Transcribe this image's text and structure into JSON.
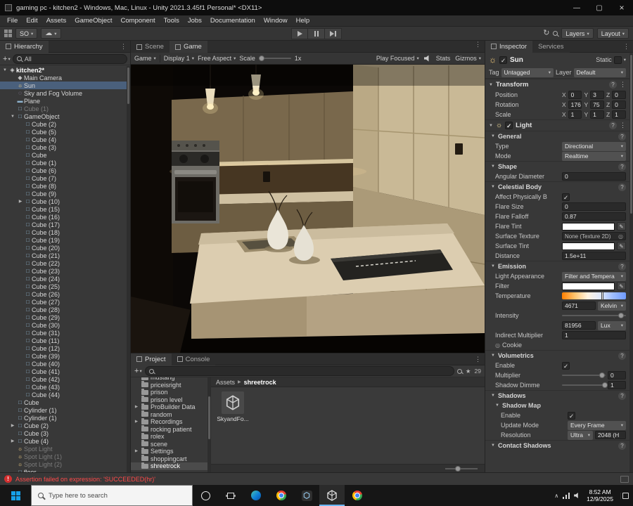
{
  "window": {
    "title": "gaming pc - kitchen2 - Windows, Mac, Linux - Unity 2021.3.45f1 Personal* <DX11>"
  },
  "menu": {
    "items": [
      "File",
      "Edit",
      "Assets",
      "GameObject",
      "Component",
      "Tools",
      "Jobs",
      "Documentation",
      "Window",
      "Help"
    ]
  },
  "toolbar": {
    "account_label": "SO",
    "layers_label": "Layers",
    "layout_label": "Layout"
  },
  "hierarchy": {
    "tab": "Hierarchy",
    "search_value": "All",
    "items": [
      {
        "label": "kitchen2*",
        "indent": 0,
        "icon": "unity",
        "arrow": "open",
        "root": true
      },
      {
        "label": "Main Camera",
        "indent": 1,
        "icon": "camera"
      },
      {
        "label": "Sun",
        "indent": 1,
        "icon": "light",
        "state": "selected"
      },
      {
        "label": "Sky and Fog Volume",
        "indent": 1,
        "icon": "volume"
      },
      {
        "label": "Plane",
        "indent": 1,
        "icon": "plane"
      },
      {
        "label": "Cube (1)",
        "indent": 1,
        "icon": "cube",
        "state": "disabled"
      },
      {
        "label": "GameObject",
        "indent": 1,
        "icon": "cube",
        "arrow": "open"
      },
      {
        "label": "Cube (2)",
        "indent": 2,
        "icon": "cube"
      },
      {
        "label": "Cube (5)",
        "indent": 2,
        "icon": "cube"
      },
      {
        "label": "Cube (4)",
        "indent": 2,
        "icon": "cube"
      },
      {
        "label": "Cube (3)",
        "indent": 2,
        "icon": "cube"
      },
      {
        "label": "Cube",
        "indent": 2,
        "icon": "cube"
      },
      {
        "label": "Cube (1)",
        "indent": 2,
        "icon": "cube"
      },
      {
        "label": "Cube (6)",
        "indent": 2,
        "icon": "cube"
      },
      {
        "label": "Cube (7)",
        "indent": 2,
        "icon": "cube"
      },
      {
        "label": "Cube (8)",
        "indent": 2,
        "icon": "cube"
      },
      {
        "label": "Cube (9)",
        "indent": 2,
        "icon": "cube"
      },
      {
        "label": "Cube (10)",
        "indent": 2,
        "icon": "cube",
        "arrow": "closed"
      },
      {
        "label": "Cube (15)",
        "indent": 2,
        "icon": "cube"
      },
      {
        "label": "Cube (16)",
        "indent": 2,
        "icon": "cube"
      },
      {
        "label": "Cube (17)",
        "indent": 2,
        "icon": "cube"
      },
      {
        "label": "Cube (18)",
        "indent": 2,
        "icon": "cube"
      },
      {
        "label": "Cube (19)",
        "indent": 2,
        "icon": "cube"
      },
      {
        "label": "Cube (20)",
        "indent": 2,
        "icon": "cube"
      },
      {
        "label": "Cube (21)",
        "indent": 2,
        "icon": "cube"
      },
      {
        "label": "Cube (22)",
        "indent": 2,
        "icon": "cube"
      },
      {
        "label": "Cube (23)",
        "indent": 2,
        "icon": "cube"
      },
      {
        "label": "Cube (24)",
        "indent": 2,
        "icon": "cube"
      },
      {
        "label": "Cube (25)",
        "indent": 2,
        "icon": "cube"
      },
      {
        "label": "Cube (26)",
        "indent": 2,
        "icon": "cube"
      },
      {
        "label": "Cube (27)",
        "indent": 2,
        "icon": "cube"
      },
      {
        "label": "Cube (28)",
        "indent": 2,
        "icon": "cube"
      },
      {
        "label": "Cube (29)",
        "indent": 2,
        "icon": "cube"
      },
      {
        "label": "Cube (30)",
        "indent": 2,
        "icon": "cube"
      },
      {
        "label": "Cube (31)",
        "indent": 2,
        "icon": "cube"
      },
      {
        "label": "Cube (11)",
        "indent": 2,
        "icon": "cube"
      },
      {
        "label": "Cube (12)",
        "indent": 2,
        "icon": "cube"
      },
      {
        "label": "Cube (39)",
        "indent": 2,
        "icon": "cube"
      },
      {
        "label": "Cube (40)",
        "indent": 2,
        "icon": "cube"
      },
      {
        "label": "Cube (41)",
        "indent": 2,
        "icon": "cube"
      },
      {
        "label": "Cube (42)",
        "indent": 2,
        "icon": "cube"
      },
      {
        "label": "Cube (43)",
        "indent": 2,
        "icon": "cube"
      },
      {
        "label": "Cube (44)",
        "indent": 2,
        "icon": "cube"
      },
      {
        "label": "Cube",
        "indent": 1,
        "icon": "cube"
      },
      {
        "label": "Cylinder (1)",
        "indent": 1,
        "icon": "cube"
      },
      {
        "label": "Cylinder (1)",
        "indent": 1,
        "icon": "cube"
      },
      {
        "label": "Cube (2)",
        "indent": 1,
        "icon": "cube",
        "arrow": "closed"
      },
      {
        "label": "Cube (3)",
        "indent": 1,
        "icon": "cube"
      },
      {
        "label": "Cube (4)",
        "indent": 1,
        "icon": "cube",
        "arrow": "closed"
      },
      {
        "label": "Spot Light",
        "indent": 1,
        "icon": "light",
        "state": "disabled"
      },
      {
        "label": "Spot Light (1)",
        "indent": 1,
        "icon": "light",
        "state": "disabled"
      },
      {
        "label": "Spot Light (2)",
        "indent": 1,
        "icon": "light",
        "state": "disabled"
      },
      {
        "label": "floor",
        "indent": 1,
        "icon": "cube"
      }
    ]
  },
  "scene_tabs": {
    "scene": "Scene",
    "game": "Game"
  },
  "game_toolbar": {
    "display_target": "Game",
    "display": "Display 1",
    "aspect": "Free Aspect",
    "scale_label": "Scale",
    "scale_value": "1x",
    "focus_mode": "Play Focused",
    "stats_label": "Stats",
    "gizmos_label": "Gizmos"
  },
  "project": {
    "tab_project": "Project",
    "tab_console": "Console",
    "hidden_count": "29",
    "folders": [
      {
        "label": "mustang"
      },
      {
        "label": "priceisright"
      },
      {
        "label": "prison"
      },
      {
        "label": "prison level"
      },
      {
        "label": "ProBuilder Data",
        "arrow": true
      },
      {
        "label": "random"
      },
      {
        "label": "Recordings",
        "arrow": true
      },
      {
        "label": "rocking patient"
      },
      {
        "label": "rolex"
      },
      {
        "label": "scene"
      },
      {
        "label": "Settings",
        "arrow": true
      },
      {
        "label": "shoppingcart"
      },
      {
        "label": "shreetrock",
        "selected": true
      }
    ],
    "breadcrumb": {
      "root": "Assets",
      "current": "shreetrock"
    },
    "assets": [
      {
        "label": "SkyandFo..."
      }
    ]
  },
  "inspector": {
    "tab_inspector": "Inspector",
    "tab_services": "Services",
    "header": {
      "name": "Sun",
      "static_label": "Static"
    },
    "tag_label": "Tag",
    "tag_value": "Untagged",
    "layer_label": "Layer",
    "layer_value": "Default",
    "transform": {
      "title": "Transform",
      "axes": [
        "X",
        "Y",
        "Z"
      ],
      "rows": [
        {
          "label": "Position",
          "x": "0",
          "y": "3",
          "z": "0"
        },
        {
          "label": "Rotation",
          "x": "176.5",
          "y": "75",
          "z": "0"
        },
        {
          "label": "Scale",
          "x": "1",
          "y": "1",
          "z": "1"
        }
      ]
    },
    "light": {
      "title": "Light",
      "sections": [
        {
          "title": "General",
          "rows": [
            {
              "label": "Type",
              "control": "dropdown",
              "value": "Directional"
            },
            {
              "label": "Mode",
              "control": "dropdown",
              "value": "Realtime"
            }
          ]
        },
        {
          "title": "Shape",
          "rows": [
            {
              "label": "Angular Diameter",
              "control": "number",
              "value": "0"
            }
          ]
        },
        {
          "title": "Celestial Body",
          "rows": [
            {
              "label": "Affect Physically B",
              "control": "check",
              "checked": true
            },
            {
              "label": "Flare Size",
              "control": "number",
              "value": "0"
            },
            {
              "label": "Flare Falloff",
              "control": "number",
              "value": "0.87"
            },
            {
              "label": "Flare Tint",
              "control": "color"
            },
            {
              "label": "Surface Texture",
              "control": "object",
              "value": "None (Texture 2D)"
            },
            {
              "label": "Surface Tint",
              "control": "color"
            },
            {
              "label": "Distance",
              "control": "number",
              "value": "1.5e+11"
            }
          ]
        },
        {
          "title": "Emission",
          "rows": [
            {
              "label": "Light Appearance",
              "control": "dropdown",
              "value": "Filter and Tempera"
            },
            {
              "label": "Filter",
              "control": "color"
            },
            {
              "label": "Temperature",
              "control": "temp",
              "pos": 62
            },
            {
              "label": "",
              "control": "unit",
              "value": "4671",
              "unit": "Kelvin"
            },
            {
              "label": "Intensity",
              "control": "slider",
              "pos": 88
            },
            {
              "label": "",
              "control": "unit",
              "value": "81956",
              "unit": "Lux"
            },
            {
              "label": "Indirect Multiplier",
              "control": "number",
              "value": "1"
            },
            {
              "label": "Cookie",
              "control": "objicon"
            }
          ]
        },
        {
          "title": "Volumetrics",
          "rows": [
            {
              "label": "Enable",
              "control": "check",
              "checked": true
            },
            {
              "label": "Multiplier",
              "control": "slidernum",
              "value": "0",
              "pos": 86
            },
            {
              "label": "Shadow Dimme",
              "control": "slidernum",
              "value": "1",
              "pos": 92
            }
          ]
        },
        {
          "title": "Shadows",
          "rows": [
            {
              "label": "Shadow Map",
              "control": "subheader"
            },
            {
              "label": "Enable",
              "control": "check",
              "checked": true,
              "indent": 1
            },
            {
              "label": "Update Mode",
              "control": "dropdown",
              "value": "Every Frame",
              "indent": 1
            },
            {
              "label": "Resolution",
              "control": "dropdown2",
              "value": "Ultra",
              "value2": "2048 (H",
              "indent": 1
            }
          ]
        },
        {
          "title": "Contact Shadows",
          "rows": []
        }
      ]
    }
  },
  "status_bar": {
    "message": "Assertion failed on expression: 'SUCCEEDED(hr)'"
  },
  "taskbar": {
    "search_placeholder": "Type here to search",
    "time": "8:52 AM",
    "date": "12/9/2025"
  },
  "colors": {
    "selection": "#4a607c",
    "error_text": "#ff4a4a",
    "taskbar_accent": "#6cb8f8"
  }
}
